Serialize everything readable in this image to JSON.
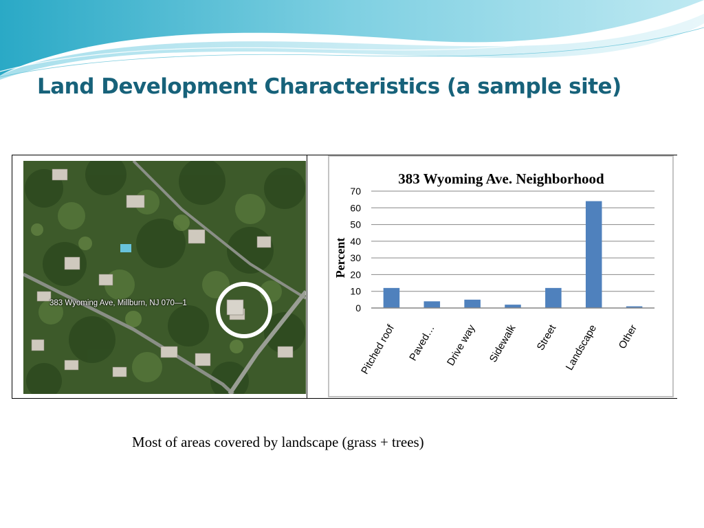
{
  "slide": {
    "title": "Land Development Characteristics (a sample site)",
    "caption": "Most of areas covered by landscape (grass + trees)",
    "title_color": "#17627a"
  },
  "aerial_image": {
    "label": "383 Wyoming Ave, Millburn, NJ 070—1"
  },
  "chart_data": {
    "type": "bar",
    "title": "383 Wyoming Ave. Neighborhood",
    "xlabel": "",
    "ylabel": "Percent",
    "categories": [
      "Pitched roof",
      "Paved…",
      "Drive way",
      "Sidewalk",
      "Street",
      "Landscape",
      "Other"
    ],
    "values": [
      12,
      4,
      5,
      2,
      12,
      64,
      1
    ],
    "ylim": [
      0,
      70
    ],
    "yticks": [
      0,
      10,
      20,
      30,
      40,
      50,
      60,
      70
    ],
    "grid": true,
    "legend": "none",
    "bar_color": "#4f81bd"
  }
}
